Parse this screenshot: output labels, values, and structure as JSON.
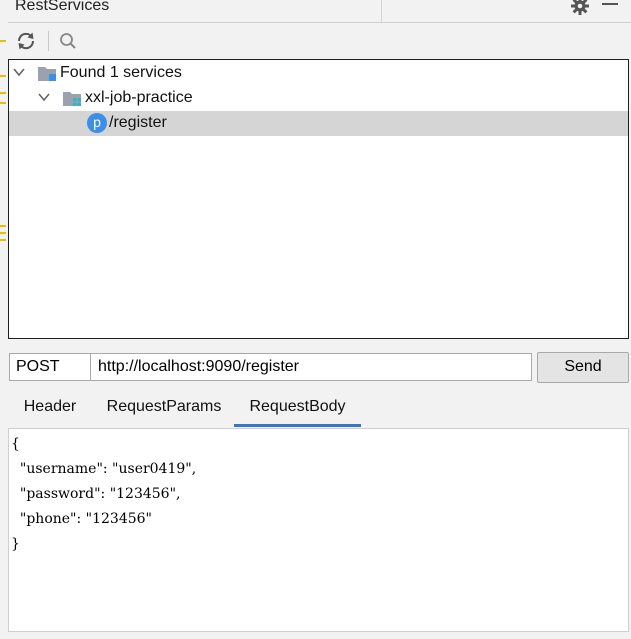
{
  "panel": {
    "title": "RestServices"
  },
  "icons": {
    "gear": "gear-icon",
    "minimize": "minimize-icon",
    "refresh": "refresh-icon",
    "search": "search-icon",
    "service_badge_letter": "p"
  },
  "tree": {
    "root_label": "Found 1 services",
    "module_label": "xxl-job-practice",
    "endpoint_label": "/register"
  },
  "request": {
    "method": "POST",
    "url": "http://localhost:9090/register",
    "send_label": "Send"
  },
  "tabs": [
    {
      "label": "Header",
      "active": false
    },
    {
      "label": "RequestParams",
      "active": false
    },
    {
      "label": "RequestBody",
      "active": true
    }
  ],
  "body": {
    "text": "{\n  \"username\": \"user0419\",\n  \"password\": \"123456\",\n  \"phone\": \"123456\"\n}"
  },
  "colors": {
    "accent": "#3874c8",
    "badge": "#3d8fe6",
    "selection": "#d5d5d5"
  }
}
